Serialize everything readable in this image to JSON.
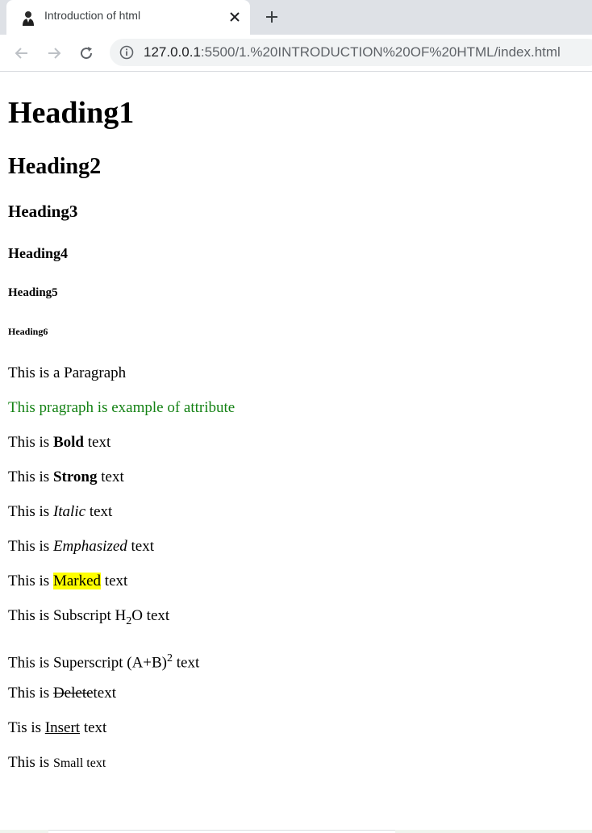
{
  "browser": {
    "tab_title": "Introduction of html",
    "url_host": "127.0.0.1",
    "url_path": ":5500/1.%20INTRODUCTION%20OF%20HTML/index.html",
    "favicon": "avatar-favicon",
    "icons": {
      "close": "close-icon",
      "new_tab": "plus-icon",
      "back": "back-arrow-icon",
      "forward": "forward-arrow-icon",
      "reload": "reload-icon",
      "info": "info-icon"
    }
  },
  "content": {
    "h1": "Heading1",
    "h2": "Heading2",
    "h3": "Heading3",
    "h4": "Heading4",
    "h5": "Heading5",
    "h6": "Heading6",
    "paragraph": "This is a Paragraph",
    "attribute_paragraph": "This pragraph is example of attribute",
    "attribute_color": "#148214",
    "bold_line": {
      "prefix": "This is ",
      "emphasis": "Bold",
      "suffix": " text"
    },
    "strong_line": {
      "prefix": "This is ",
      "emphasis": "Strong",
      "suffix": " text"
    },
    "italic_line": {
      "prefix": "This is ",
      "emphasis": "Italic",
      "suffix": " text"
    },
    "em_line": {
      "prefix": "This is ",
      "emphasis": "Emphasized",
      "suffix": " text"
    },
    "mark_line": {
      "prefix": "This is ",
      "emphasis": "Marked",
      "suffix": " text"
    },
    "mark_color": "#ffff00",
    "sub_line": {
      "prefix": "This is Subscript H",
      "sub": "2",
      "after": "O text"
    },
    "sup_line": {
      "prefix": "This is Superscript (A+B)",
      "sup": "2",
      "after": " text"
    },
    "del_line": {
      "prefix": "This is ",
      "emphasis": "Delete",
      "suffix": "text"
    },
    "ins_line": {
      "prefix": "Tis is ",
      "emphasis": "Insert",
      "suffix": " text"
    },
    "small_line": {
      "prefix": "This is ",
      "emphasis": "Small text"
    }
  }
}
